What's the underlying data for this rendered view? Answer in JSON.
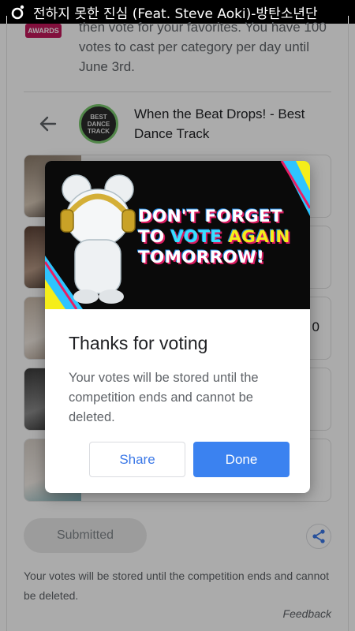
{
  "status_bar": {
    "now_playing": "전하지 못한 진심 (Feat. Steve Aoki)-방탄소년단"
  },
  "background": {
    "intro_text": "then vote for your favorites. You have 100 votes to cast per category per day until June 3rd.",
    "category": {
      "title": "When the Beat Drops! - Best Dance Track",
      "thumb_text": "BEST DANCE TRACK"
    },
    "nominee_values": [
      "",
      "",
      "0",
      "",
      ""
    ],
    "submitted_label": "Submitted",
    "bottom_note": "Your votes will be stored until the competition ends and cannot be deleted.",
    "feedback_label": "Feedback"
  },
  "dialog": {
    "banner": {
      "line1": "DON'T FORGET",
      "line2_a": "TO ",
      "line2_b": "VOTE ",
      "line2_c": "AGAIN",
      "line3": "TOMORROW!"
    },
    "title": "Thanks for voting",
    "body": "Your votes will be stored until the competition ends and cannot be deleted.",
    "share_label": "Share",
    "done_label": "Done"
  },
  "colors": {
    "primary_blue": "#3b82f0",
    "banner_yellow": "#f5ee1a",
    "banner_cyan": "#39e0ff"
  }
}
